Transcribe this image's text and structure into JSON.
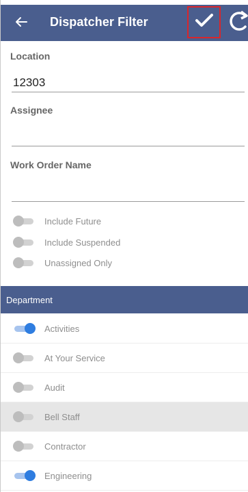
{
  "header": {
    "title": "Dispatcher Filter",
    "back_icon": "back-arrow-icon",
    "confirm_icon": "checkmark-icon",
    "refresh_icon": "refresh-icon",
    "bar_color": "#4a5e8e",
    "confirm_outline_color": "#d9262b"
  },
  "form": {
    "location": {
      "label": "Location",
      "value": "12303"
    },
    "assignee": {
      "label": "Assignee",
      "value": ""
    },
    "work_order_name": {
      "label": "Work Order Name",
      "value": ""
    }
  },
  "options": [
    {
      "label": "Include Future",
      "on": false
    },
    {
      "label": "Include Suspended",
      "on": false
    },
    {
      "label": "Unassigned Only",
      "on": false
    }
  ],
  "department": {
    "header": "Department",
    "items": [
      {
        "label": "Activities",
        "on": true
      },
      {
        "label": "At Your Service",
        "on": false
      },
      {
        "label": "Audit",
        "on": false
      },
      {
        "label": "Bell Staff",
        "on": false,
        "highlighted": true
      },
      {
        "label": "Contractor",
        "on": false
      },
      {
        "label": "Engineering",
        "on": true
      }
    ]
  },
  "colors": {
    "toggle_on": "#2f7de0",
    "toggle_off": "#bdbdbd"
  }
}
